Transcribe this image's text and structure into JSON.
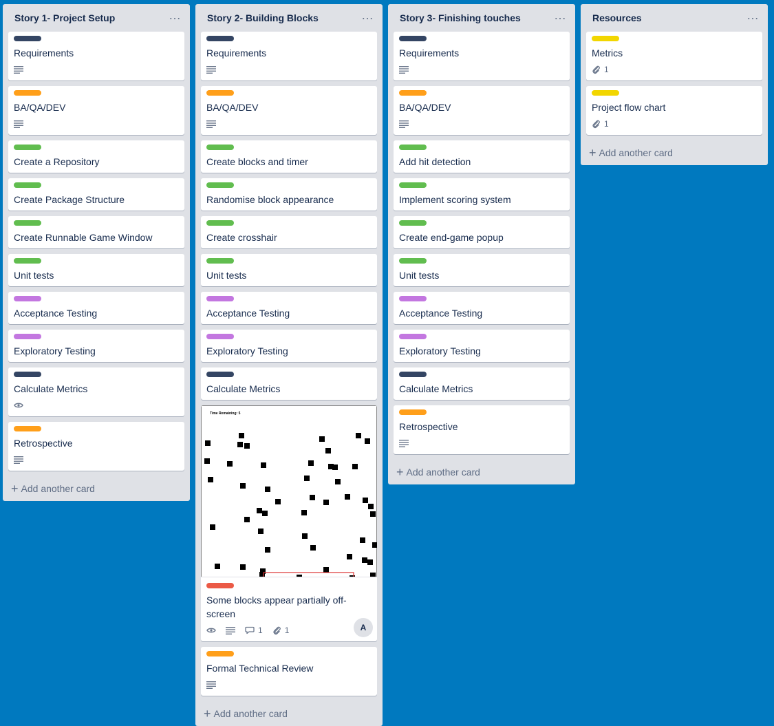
{
  "colors": {
    "board_bg": "#0079bf",
    "label_dark": "#344563",
    "label_orange": "#ff9f1a",
    "label_green": "#61bd4f",
    "label_purple": "#c377e0",
    "label_yellow": "#f2d600",
    "label_red": "#eb5a46"
  },
  "lists": [
    {
      "title": "Story 1- Project Setup",
      "add_label": "Add another card",
      "cards": [
        {
          "title": "Requirements",
          "label": "#344563",
          "badges": [
            "description-icon"
          ]
        },
        {
          "title": "BA/QA/DEV",
          "label": "#ff9f1a",
          "badges": [
            "description-icon"
          ]
        },
        {
          "title": "Create a Repository",
          "label": "#61bd4f"
        },
        {
          "title": "Create Package Structure",
          "label": "#61bd4f"
        },
        {
          "title": "Create Runnable Game Window",
          "label": "#61bd4f"
        },
        {
          "title": "Unit tests",
          "label": "#61bd4f"
        },
        {
          "title": "Acceptance Testing",
          "label": "#c377e0"
        },
        {
          "title": "Exploratory Testing",
          "label": "#c377e0"
        },
        {
          "title": "Calculate Metrics",
          "label": "#344563",
          "badges": [
            "watch-icon"
          ]
        },
        {
          "title": "Retrospective",
          "label": "#ff9f1a",
          "badges": [
            "description-icon"
          ]
        }
      ]
    },
    {
      "title": "Story 2- Building Blocks",
      "add_label": "Add another card",
      "cards": [
        {
          "title": "Requirements",
          "label": "#344563",
          "badges": [
            "description-icon"
          ]
        },
        {
          "title": "BA/QA/DEV",
          "label": "#ff9f1a",
          "badges": [
            "description-icon"
          ]
        },
        {
          "title": "Create blocks and timer",
          "label": "#61bd4f"
        },
        {
          "title": "Randomise block appearance",
          "label": "#61bd4f"
        },
        {
          "title": "Create crosshair",
          "label": "#61bd4f"
        },
        {
          "title": "Unit tests",
          "label": "#61bd4f"
        },
        {
          "title": "Acceptance Testing",
          "label": "#c377e0"
        },
        {
          "title": "Exploratory Testing",
          "label": "#c377e0"
        },
        {
          "title": "Calculate Metrics",
          "label": "#344563"
        },
        {
          "title": "Some blocks appear partially off-screen",
          "label": "#eb5a46",
          "cover": {
            "caption": "Time Remaining: 5"
          },
          "badges": [
            "watch-icon",
            "description-icon",
            "comment-icon",
            "attachment-icon"
          ],
          "comment_count": "1",
          "attachment_count": "1",
          "member_initial": "A"
        },
        {
          "title": "Formal Technical Review",
          "label": "#ff9f1a",
          "badges": [
            "description-icon"
          ]
        }
      ]
    },
    {
      "title": "Story 3- Finishing touches",
      "add_label": "Add another card",
      "cards": [
        {
          "title": "Requirements",
          "label": "#344563",
          "badges": [
            "description-icon"
          ]
        },
        {
          "title": "BA/QA/DEV",
          "label": "#ff9f1a",
          "badges": [
            "description-icon"
          ]
        },
        {
          "title": "Add hit detection",
          "label": "#61bd4f"
        },
        {
          "title": "Implement scoring system",
          "label": "#61bd4f"
        },
        {
          "title": "Create end-game popup",
          "label": "#61bd4f"
        },
        {
          "title": "Unit tests",
          "label": "#61bd4f"
        },
        {
          "title": "Acceptance Testing",
          "label": "#c377e0"
        },
        {
          "title": "Exploratory Testing",
          "label": "#c377e0"
        },
        {
          "title": "Calculate Metrics",
          "label": "#344563"
        },
        {
          "title": "Retrospective",
          "label": "#ff9f1a",
          "badges": [
            "description-icon"
          ]
        }
      ]
    },
    {
      "title": "Resources",
      "add_label": "Add another card",
      "cards": [
        {
          "title": "Metrics",
          "label": "#f2d600",
          "badges": [
            "attachment-icon"
          ],
          "attachment_count": "1"
        },
        {
          "title": "Project flow chart",
          "label": "#f2d600",
          "badges": [
            "attachment-icon"
          ],
          "attachment_count": "1"
        }
      ]
    }
  ]
}
